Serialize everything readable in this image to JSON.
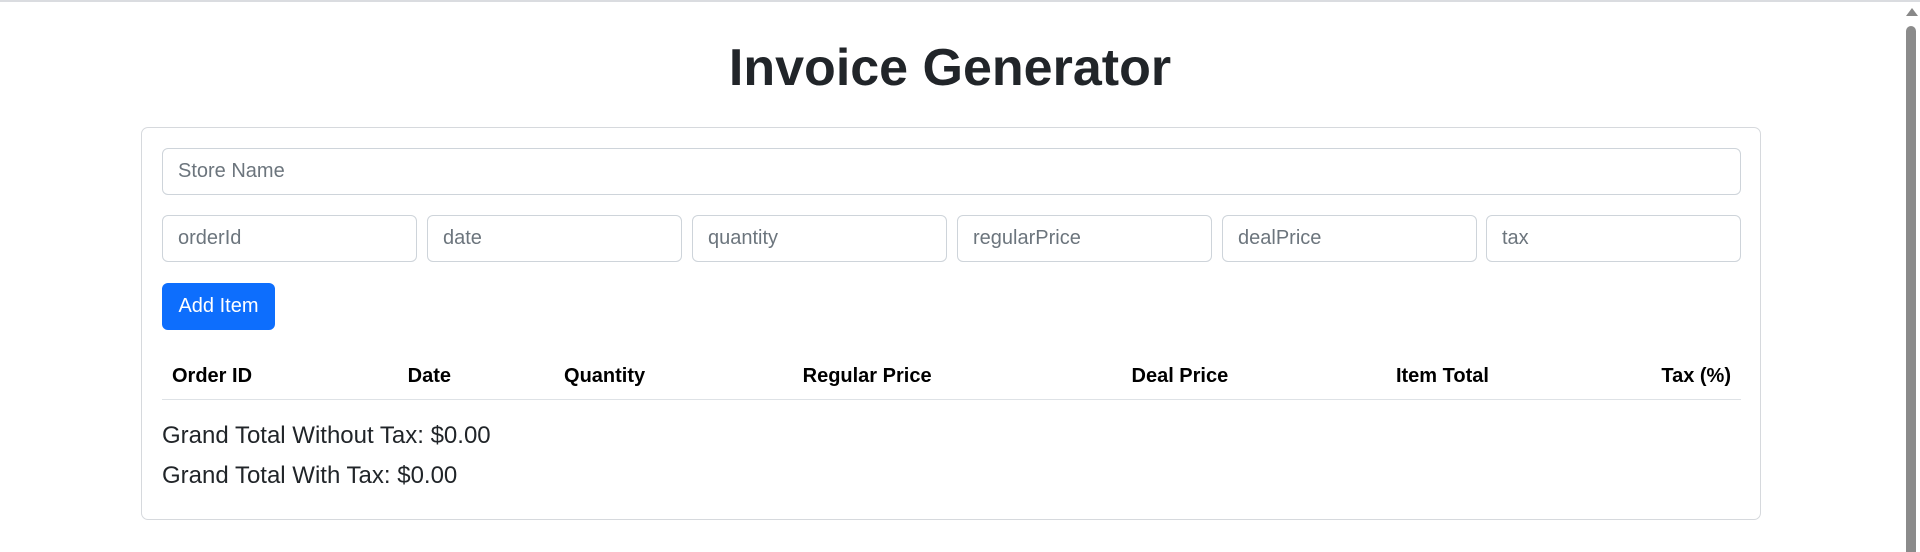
{
  "page": {
    "title": "Invoice Generator"
  },
  "form": {
    "store_name_placeholder": "Store Name",
    "fields": [
      {
        "placeholder": "orderId"
      },
      {
        "placeholder": "date"
      },
      {
        "placeholder": "quantity"
      },
      {
        "placeholder": "regularPrice"
      },
      {
        "placeholder": "dealPrice"
      },
      {
        "placeholder": "tax"
      }
    ],
    "add_button_label": "Add Item"
  },
  "table": {
    "headers": [
      "Order ID",
      "Date",
      "Quantity",
      "Regular Price",
      "Deal Price",
      "Item Total",
      "Tax (%)"
    ],
    "rows": []
  },
  "totals": {
    "without_tax": "Grand Total Without Tax: $0.00",
    "with_tax": "Grand Total With Tax: $0.00"
  },
  "colors": {
    "accent": "#0d6efd"
  }
}
